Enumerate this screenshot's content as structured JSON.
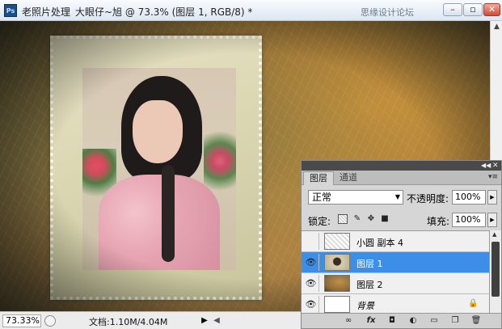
{
  "window": {
    "app_title": "老照片处理",
    "doc_title": "大眼仔~旭 @ 73.3% (图层 1, RGB/8) *",
    "watermark": "思缘设计论坛",
    "app_icon_label": "Ps"
  },
  "statusbar": {
    "zoom": "73.33%",
    "doc_info": "文档:1.10M/4.04M"
  },
  "layers_panel": {
    "tabs": [
      "图层",
      "通道"
    ],
    "blend_mode": "正常",
    "opacity_label": "不透明度:",
    "opacity_value": "100%",
    "lock_label": "锁定:",
    "fill_label": "填充:",
    "fill_value": "100%",
    "layers": [
      {
        "name": "小圆 副本 4",
        "visible": false,
        "selected": false,
        "italic": false,
        "locked": false
      },
      {
        "name": "图层 1",
        "visible": true,
        "selected": true,
        "italic": false,
        "locked": false
      },
      {
        "name": "图层 2",
        "visible": true,
        "selected": false,
        "italic": false,
        "locked": false
      },
      {
        "name": "背景",
        "visible": true,
        "selected": false,
        "italic": true,
        "locked": true
      }
    ],
    "bottom_icons": [
      "link-icon",
      "fx-icon",
      "mask-icon",
      "adjustment-icon",
      "group-icon",
      "new-layer-icon",
      "trash-icon"
    ]
  }
}
